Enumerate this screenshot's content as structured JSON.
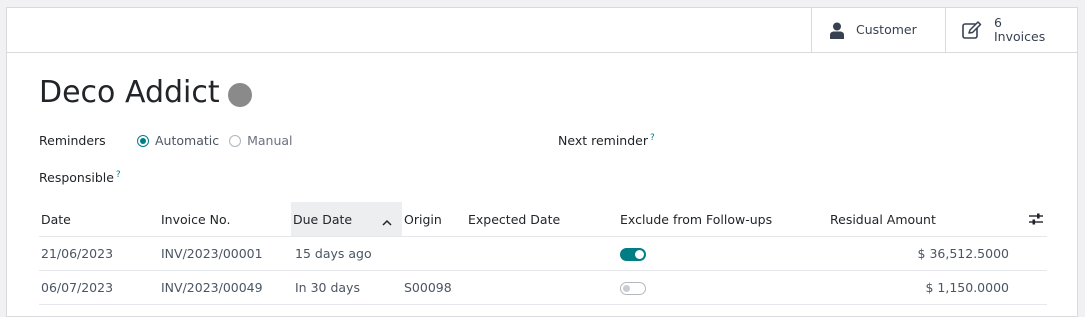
{
  "stat_buttons": {
    "customer_label": "Customer",
    "invoices_count": "6",
    "invoices_label": "Invoices"
  },
  "partner": {
    "name": "Deco Addict",
    "status_color": "#8a8a8a"
  },
  "fields": {
    "reminders_label": "Reminders",
    "reminders_options": [
      "Automatic",
      "Manual"
    ],
    "reminders_selected": "Automatic",
    "next_reminder_label": "Next reminder",
    "responsible_label": "Responsible",
    "help_mark": "?"
  },
  "table": {
    "columns": [
      "Date",
      "Invoice No.",
      "Due Date",
      "Origin",
      "Expected Date",
      "Exclude from Follow-ups",
      "Residual Amount"
    ],
    "sorted_column": "Due Date",
    "sort_direction": "ascending",
    "rows": [
      {
        "date": "21/06/2023",
        "invoice": "INV/2023/00001",
        "due": "15 days ago",
        "due_overdue": true,
        "origin": "",
        "expected": "",
        "excluded": true,
        "residual": "$ 36,512.5000"
      },
      {
        "date": "06/07/2023",
        "invoice": "INV/2023/00049",
        "due": "In 30 days",
        "due_overdue": false,
        "origin": "S00098",
        "expected": "",
        "excluded": false,
        "residual": "$ 1,150.0000"
      }
    ]
  },
  "colors": {
    "accent": "#017e84",
    "overdue": "#d23f3a"
  }
}
